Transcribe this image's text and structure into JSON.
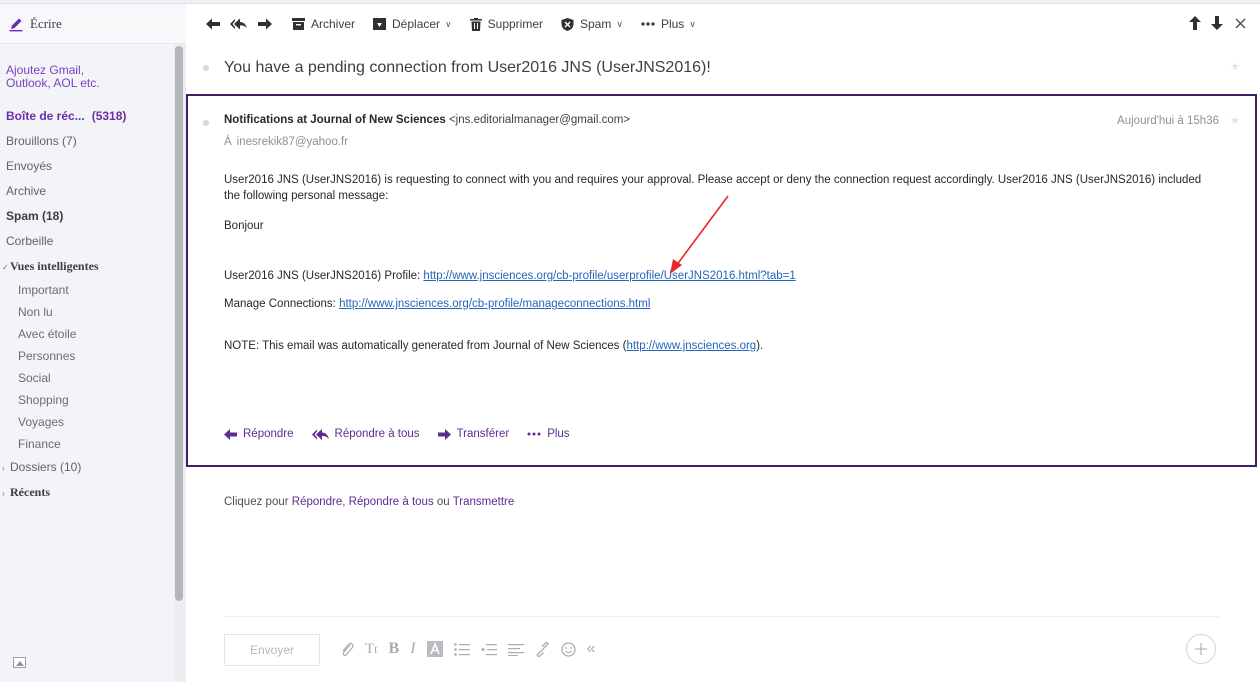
{
  "sidebar": {
    "compose_label": "Écrire",
    "add_accounts": [
      "Ajoutez Gmail,",
      "Outlook, AOL etc."
    ],
    "inbox": {
      "label": "Boîte de réc...",
      "count": "(5318)"
    },
    "drafts": "Brouillons (7)",
    "sent": "Envoyés",
    "archive": "Archive",
    "spam": "Spam (18)",
    "trash": "Corbeille",
    "smart_views": {
      "label": "Vues intelligentes",
      "items": [
        "Important",
        "Non lu",
        "Avec étoile",
        "Personnes",
        "Social",
        "Shopping",
        "Voyages",
        "Finance"
      ]
    },
    "folders": "Dossiers (10)",
    "recents": "Récents"
  },
  "toolbar": {
    "archive": "Archiver",
    "move": "Déplacer",
    "delete": "Supprimer",
    "spam": "Spam",
    "more": "Plus"
  },
  "message": {
    "subject": "You have a pending connection from User2016 JNS (UserJNS2016)!",
    "sender_name": "Notifications at Journal of New Sciences",
    "sender_email": "<jns.editorialmanager@gmail.com>",
    "date": "Aujourd'hui à 15h36",
    "to_prefix": "À",
    "to": "inesrekik87@yahoo.fr",
    "body_p1": "User2016 JNS (UserJNS2016) is requesting to connect with you and requires your approval.  Please accept or deny the connection request accordingly.  User2016 JNS (UserJNS2016) included the following personal message:",
    "body_greeting": "Bonjour",
    "profile_label": "User2016 JNS (UserJNS2016) Profile: ",
    "profile_url": "http://www.jnsciences.org/cb-profile/userprofile/UserJNS2016.html?tab=1",
    "manage_label": "Manage Connections: ",
    "manage_url": "http://www.jnsciences.org/cb-profile/manageconnections.html",
    "note_prefix": "NOTE: This email was automatically generated from Journal of New Sciences (",
    "note_url": "http://www.jnsciences.org",
    "note_suffix": ").",
    "actions": {
      "reply": "Répondre",
      "reply_all": "Répondre à tous",
      "forward": "Transférer",
      "more": "Plus"
    }
  },
  "quick_reply": {
    "prefix": "Cliquez pour ",
    "reply": "Répondre",
    "sep": ", ",
    "reply_all": "Répondre à tous",
    "or": " ou ",
    "forward": "Transmettre",
    "send_label": "Envoyer"
  },
  "annotation": {
    "arrow_color": "#e8262b"
  }
}
